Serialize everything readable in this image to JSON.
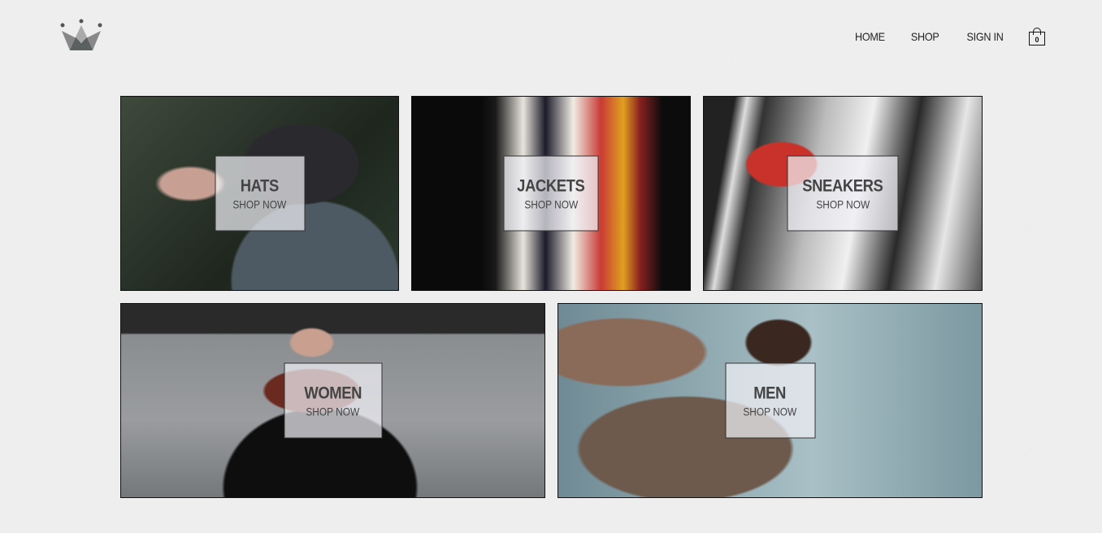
{
  "nav": {
    "home": "HOME",
    "shop": "SHOP",
    "sign_in": "SIGN IN",
    "cart_count": "0"
  },
  "categories": [
    {
      "title": "HATS",
      "cta": "SHOP NOW"
    },
    {
      "title": "JACKETS",
      "cta": "SHOP NOW"
    },
    {
      "title": "SNEAKERS",
      "cta": "SHOP NOW"
    },
    {
      "title": "WOMEN",
      "cta": "SHOP NOW"
    },
    {
      "title": "MEN",
      "cta": "SHOP NOW"
    }
  ]
}
